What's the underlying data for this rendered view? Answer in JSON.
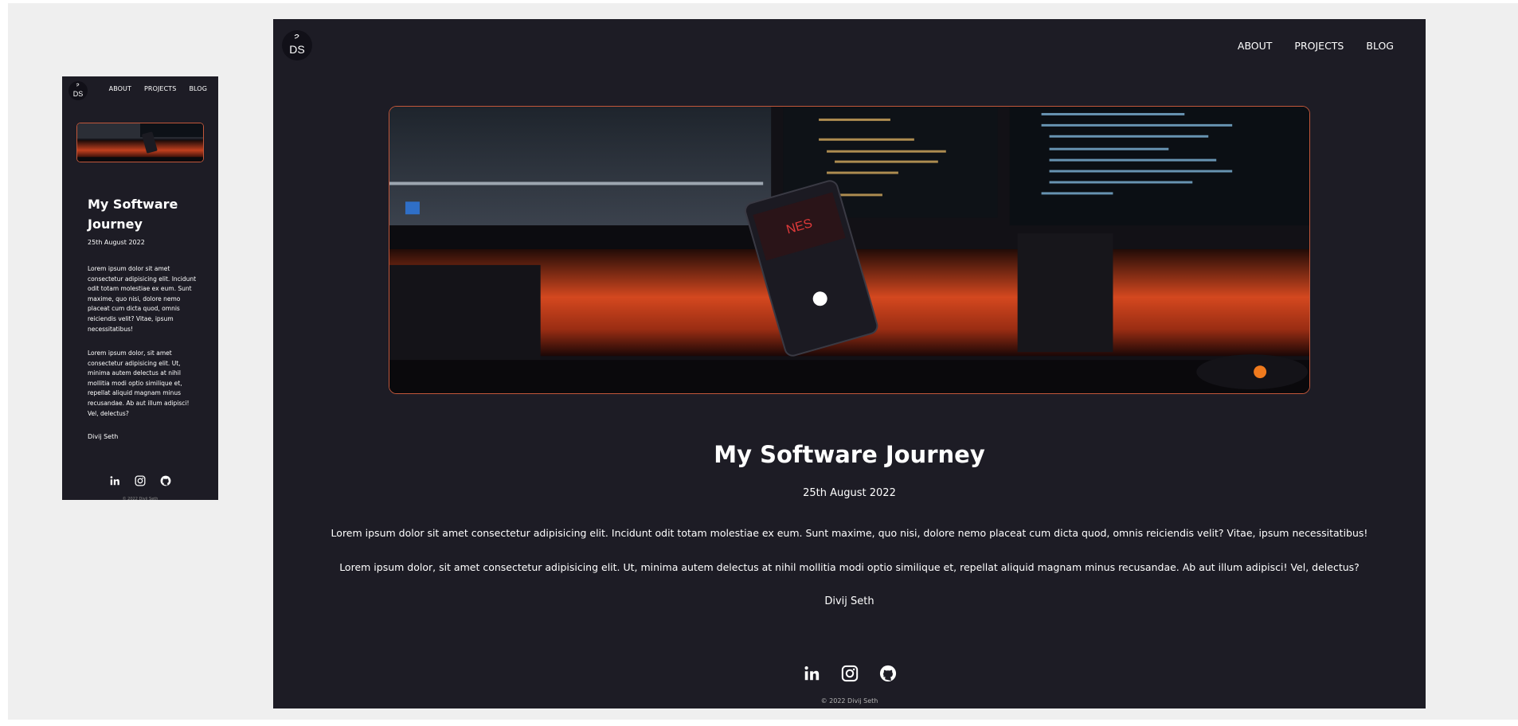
{
  "site": {
    "logo_text": "DS",
    "nav": [
      {
        "label": "ABOUT"
      },
      {
        "label": "PROJECTS"
      },
      {
        "label": "BLOG"
      }
    ]
  },
  "post": {
    "title": "My Software Journey",
    "date": "25th August 2022",
    "paragraphs": [
      "Lorem ipsum dolor sit amet consectetur adipisicing elit. Incidunt odit totam molestiae ex eum. Sunt maxime, quo nisi, dolore nemo placeat cum dicta quod, omnis reiciendis velit? Vitae, ipsum necessitatibus!",
      "Lorem ipsum dolor, sit amet consectetur adipisicing elit. Ut, minima autem delectus at nihil mollitia modi optio similique et, repellat aliquid magnam minus recusandae. Ab aut illum adipisci! Vel, delectus?"
    ],
    "author": "Divij Seth",
    "hero_image": "desk-setup-phone-monitors-image"
  },
  "social": [
    {
      "icon": "linkedin-icon"
    },
    {
      "icon": "instagram-icon"
    },
    {
      "icon": "github-icon"
    }
  ],
  "footer": {
    "copyright": "© 2022 Divij Seth"
  },
  "colors": {
    "page_bg": "#efefef",
    "site_bg": "#1d1c25",
    "accent_border": "#c2573a",
    "text": "#ffffff"
  }
}
